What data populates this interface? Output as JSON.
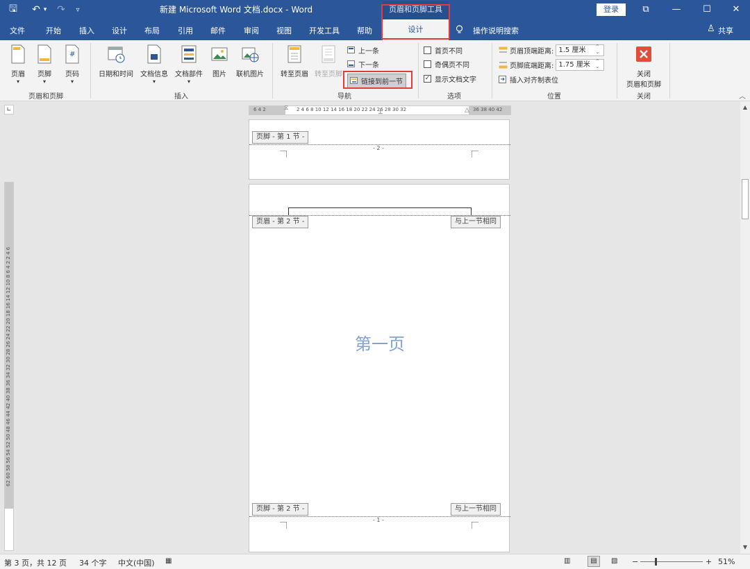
{
  "titlebar": {
    "quick_access": {
      "save": "🖫",
      "undo": "↶",
      "undo_dd": "▾",
      "redo": "↷",
      "customize": "▿"
    },
    "doc_title": "新建 Microsoft Word 文档.docx  -  Word",
    "context_title": "页眉和页脚工具",
    "login": "登录",
    "ribbon_display": "⧉",
    "minimize": "—",
    "maximize": "☐",
    "close": "✕"
  },
  "menubar": {
    "tabs": [
      "文件",
      "开始",
      "插入",
      "设计",
      "布局",
      "引用",
      "邮件",
      "审阅",
      "视图",
      "开发工具",
      "帮助"
    ],
    "active_tab": "设计",
    "tell_me": "操作说明搜索",
    "share": "共享"
  },
  "ribbon": {
    "groups": {
      "header_footer": {
        "label": "页眉和页脚",
        "buttons": [
          "页眉",
          "页脚",
          "页码"
        ]
      },
      "insert": {
        "label": "插入",
        "buttons": [
          "日期和时间",
          "文档信息",
          "文档部件",
          "图片",
          "联机图片"
        ]
      },
      "navigation": {
        "label": "导航",
        "goto_header": "转至页眉",
        "goto_footer": "转至页脚",
        "previous": "上一条",
        "next": "下一条",
        "link_previous": "链接到前一节"
      },
      "options": {
        "label": "选项",
        "first_page": "首页不同",
        "odd_even": "奇偶页不同",
        "show_text": "显示文档文字"
      },
      "position": {
        "label": "位置",
        "header_top": "页眉顶端距离:",
        "header_top_value": "1.5 厘米",
        "footer_bottom": "页脚底端距离:",
        "footer_bottom_value": "1.75 厘米",
        "insert_tab": "插入对齐制表位"
      },
      "close": {
        "label": "关闭",
        "button_line1": "关闭",
        "button_line2": "页眉和页脚"
      }
    }
  },
  "ruler": {
    "corner": "∟",
    "h_left": "6  4  2",
    "h_main": "2  4  6  8  10  12  14  16  18  20  22  24  26  28  30  32",
    "h_right": "36  38  40  42",
    "v_top": "62  60  58  56  54  52  50  48  46  44  42  40  38  36  34  32  30  28  26  24  22  20  18  16  14  12  10  8  6  4  2",
    "v_bottom": "2  4  6"
  },
  "pages": {
    "page1": {
      "footer_tag": "页脚 - 第 1 节 -",
      "page_num": "- 2 -"
    },
    "page2": {
      "header_tag": "页眉 - 第 2 节 -",
      "header_same": "与上一节相同",
      "body_text": "第一页",
      "footer_tag": "页脚 - 第 2 节 -",
      "footer_same": "与上一节相同",
      "page_num": "- 1 -"
    }
  },
  "statusbar": {
    "page_info": "第 3 页，共 12 页",
    "word_count": "34 个字",
    "language": "中文(中国)",
    "zoom": "51%",
    "zoom_level": 0.51
  },
  "colors": {
    "accent": "#2b579a",
    "highlight": "#e53b3b",
    "watermark_text": "#7fa3d6"
  }
}
